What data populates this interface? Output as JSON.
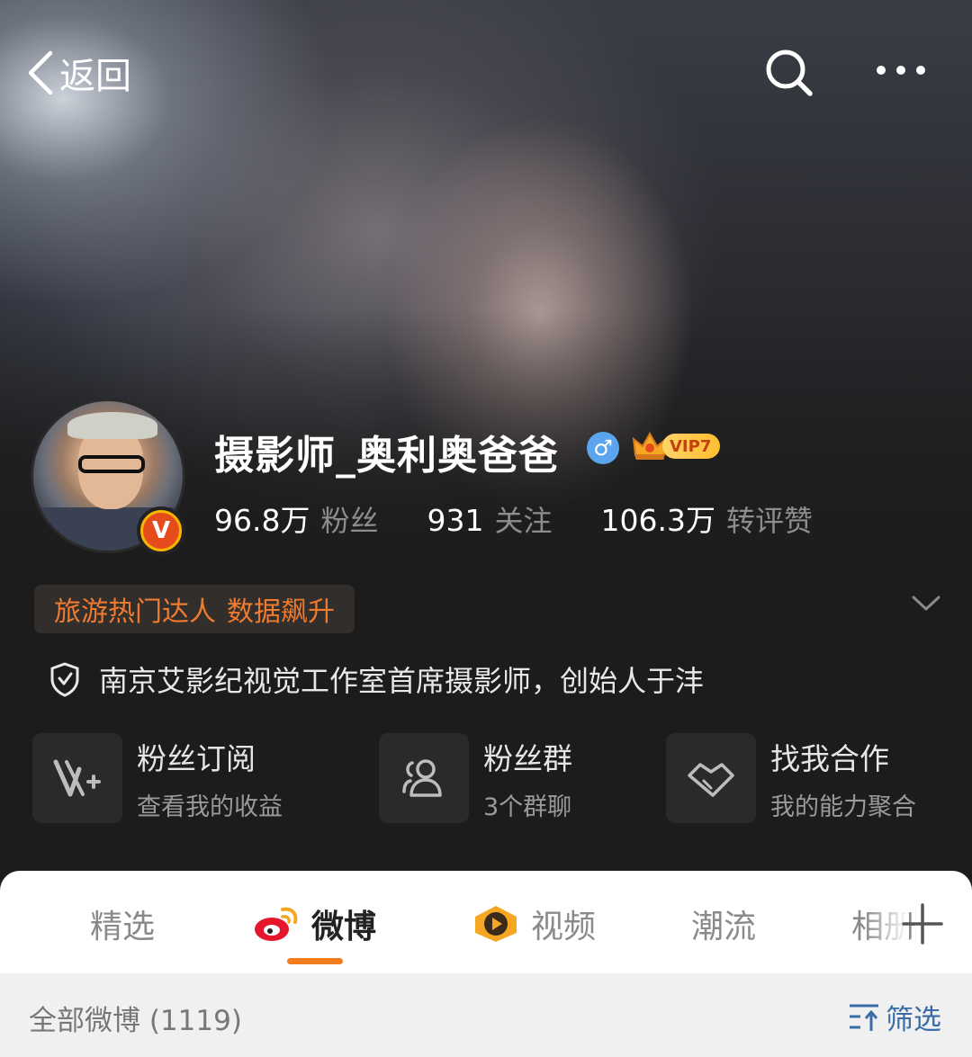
{
  "nav": {
    "back_label": "返回",
    "search_icon": "search-icon",
    "more_icon": "more-icon"
  },
  "profile": {
    "name": "摄影师_奥利奥爸爸",
    "gender_symbol": "♂",
    "vip_label": "VIP7",
    "verified_badge": "V",
    "stats": [
      {
        "num": "96.8万",
        "label": "粉丝"
      },
      {
        "num": "931",
        "label": "关注"
      },
      {
        "num": "106.3万",
        "label": "转评赞"
      }
    ],
    "tags": [
      "旅游热门达人",
      "数据飙升"
    ],
    "bio": "南京艾影纪视觉工作室首席摄影师，创始人于沣"
  },
  "cards": [
    {
      "title": "粉丝订阅",
      "subtitle": "查看我的收益",
      "icon": "v-plus-icon"
    },
    {
      "title": "粉丝群",
      "subtitle": "3个群聊",
      "icon": "group-icon"
    },
    {
      "title": "找我合作",
      "subtitle": "我的能力聚合",
      "icon": "handshake-icon"
    }
  ],
  "tabs": [
    {
      "label": "精选",
      "active": false
    },
    {
      "label": "微博",
      "active": true
    },
    {
      "label": "视频",
      "active": false
    },
    {
      "label": "潮流",
      "active": false
    },
    {
      "label": "相册",
      "active": false
    }
  ],
  "feed": {
    "count_label": "全部微博 (1119)",
    "filter_label": "筛选"
  },
  "colors": {
    "accent": "#f27d1e",
    "tag_text": "#f07b2e",
    "filter": "#3a6ca8",
    "gender": "#5aa5ee"
  }
}
